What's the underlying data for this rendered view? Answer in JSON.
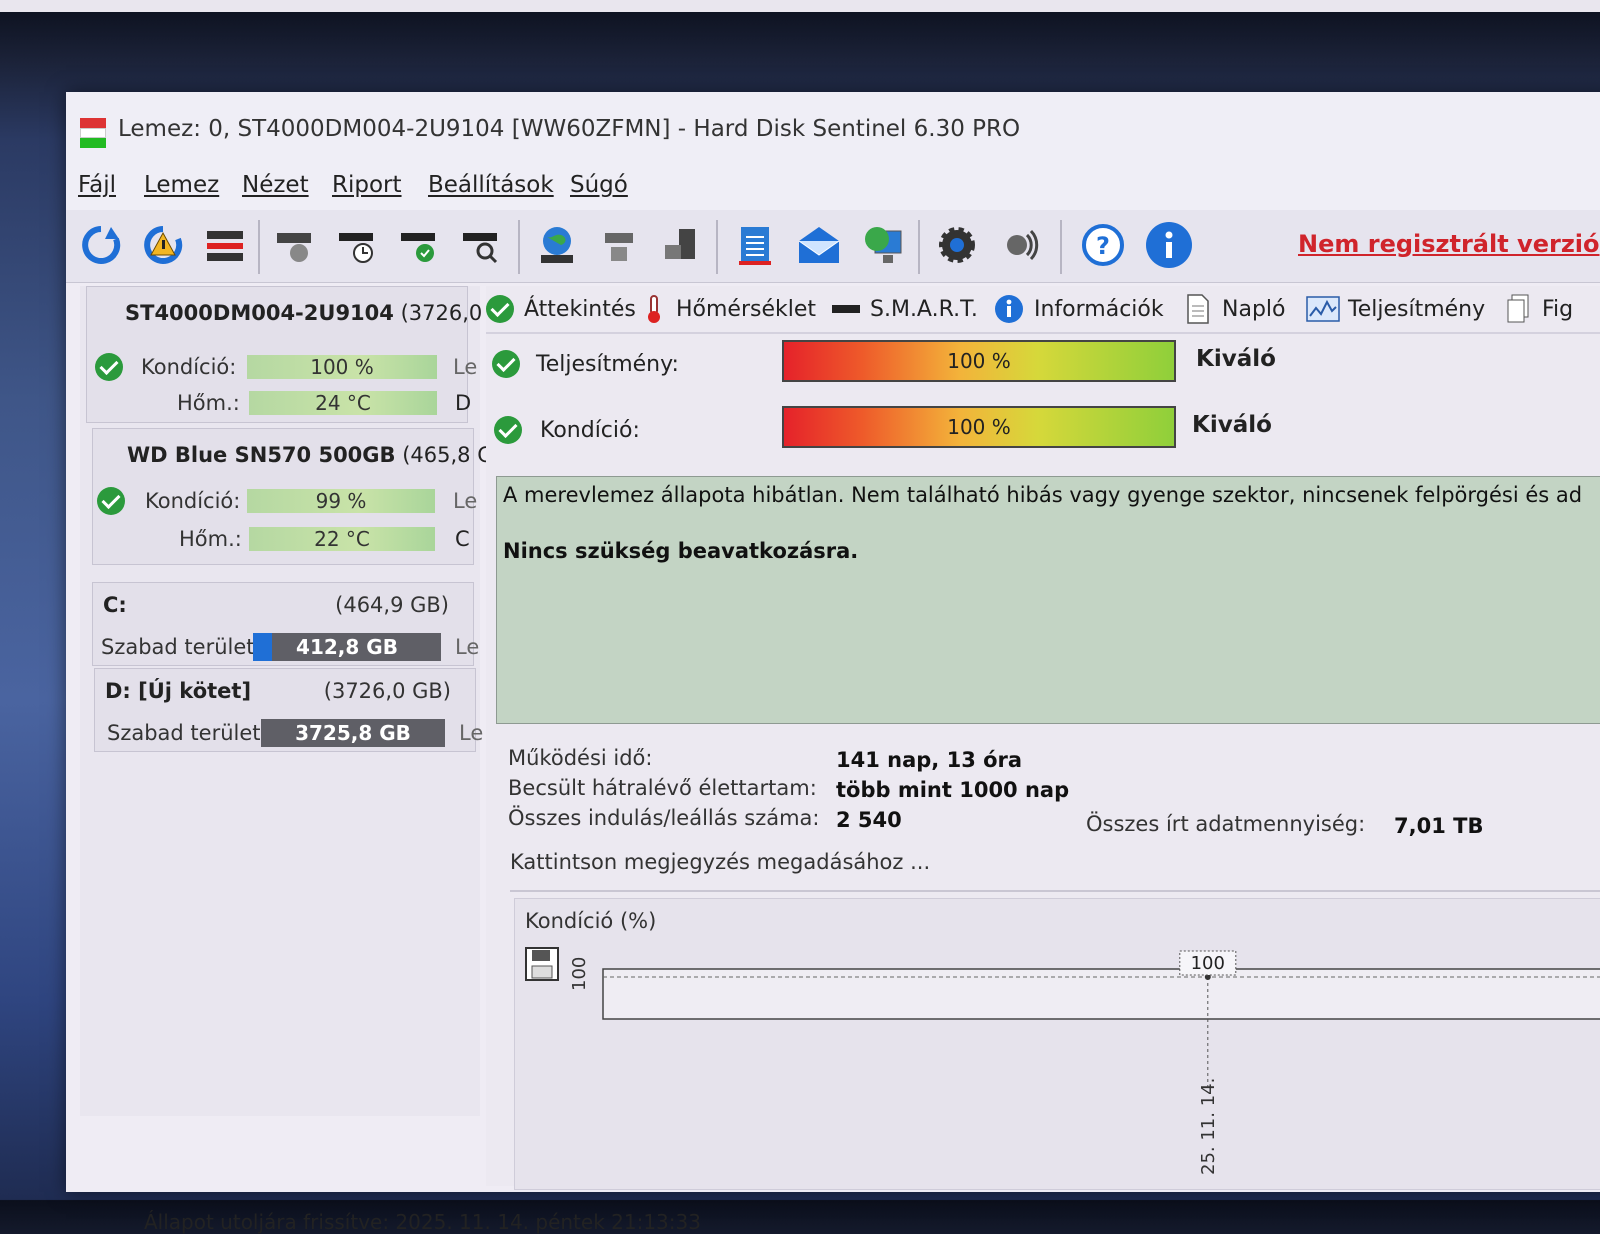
{
  "window": {
    "title": "Lemez: 0, ST4000DM004-2U9104 [WW60ZFMN]  -  Hard Disk Sentinel 6.30 PRO"
  },
  "menu": [
    "Fájl",
    "Lemez",
    "Nézet",
    "Riport",
    "Beállítások",
    "Súgó"
  ],
  "toolbar": {
    "icons": [
      "refresh-icon",
      "refresh-warning-icon",
      "disk-list-icon",
      "disk-sound-icon",
      "disk-schedule-icon",
      "disk-check-icon",
      "disk-search-icon",
      "globe-icon",
      "network-disk-icon",
      "usb-disk-icon",
      "report-icon",
      "email-icon",
      "web-report-icon",
      "settings-icon",
      "speaker-icon",
      "help-icon",
      "info-icon"
    ],
    "unregistered": "Nem regisztrált verzió"
  },
  "disks": [
    {
      "name": "ST4000DM004-2U9104",
      "size": "(3726,0",
      "condition_label": "Kondíció:",
      "condition": "100 %",
      "temp_label": "Hőm.:",
      "temp": "24 °C",
      "cut1": "Le",
      "cut2": "D"
    },
    {
      "name": "WD Blue SN570 500GB",
      "size": "(465,8 G",
      "condition_label": "Kondíció:",
      "condition": "99 %",
      "temp_label": "Hőm.:",
      "temp": "22 °C",
      "cut1": "Le",
      "cut2": "C"
    }
  ],
  "volumes": [
    {
      "name": "C:",
      "size": "(464,9 GB)",
      "free_label": "Szabad terület",
      "free": "412,8 GB",
      "cut": "Le"
    },
    {
      "name": "D: [Új kötet]",
      "size": "(3726,0 GB)",
      "free_label": "Szabad terület",
      "free": "3725,8 GB",
      "cut": "Le"
    }
  ],
  "tabs": [
    "Áttekintés",
    "Hőmérséklet",
    "S.M.A.R.T.",
    "Információk",
    "Napló",
    "Teljesítmény",
    "Fig"
  ],
  "overview": {
    "performance_label": "Teljesítmény:",
    "performance": "100 %",
    "performance_rating": "Kiváló",
    "condition_label": "Kondíció:",
    "condition": "100 %",
    "condition_rating": "Kiváló",
    "status_text": "A merevlemez állapota hibátlan. Nem található hibás vagy gyenge szektor, nincsenek felpörgési és ad",
    "status_bold": "Nincs szükség beavatkozásra.",
    "uptime_label": "Működési idő:",
    "uptime": "141 nap, 13 óra",
    "lifetime_label": "Becsült hátralévő élettartam:",
    "lifetime": "több mint 1000 nap",
    "startstop_label": "Összes indulás/leállás száma:",
    "startstop": "2 540",
    "written_label": "Összes írt adatmennyiség:",
    "written": "7,01 TB",
    "note_placeholder": "Kattintson megjegyzés megadásához ..."
  },
  "chart_data": {
    "type": "line",
    "title": "Kondíció  (%)",
    "x": [
      "25. 11. 14."
    ],
    "series": [
      {
        "values": [
          100
        ]
      }
    ],
    "y_tick": "100",
    "point_label": "100"
  },
  "statusbar": "Állapot utoljára frissítve: 2025. 11. 14. péntek 21:13:33"
}
